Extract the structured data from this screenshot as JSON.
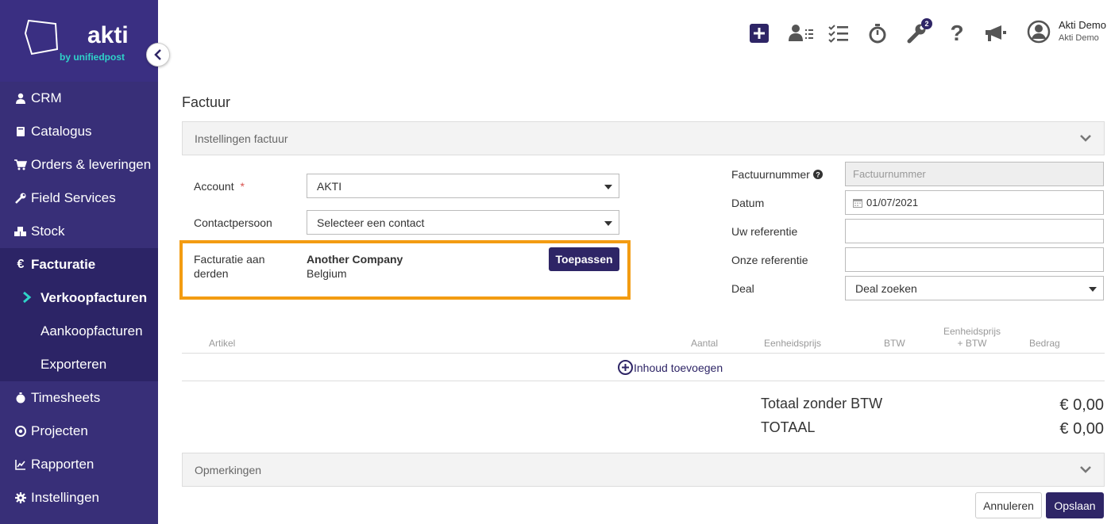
{
  "brand": {
    "name": "akti",
    "tagline": "by unifiedpost"
  },
  "sidebar": {
    "items": [
      {
        "label": "CRM",
        "icon": "user-icon"
      },
      {
        "label": "Catalogus",
        "icon": "book-icon"
      },
      {
        "label": "Orders & leveringen",
        "icon": "cart-icon"
      },
      {
        "label": "Field Services",
        "icon": "wrench-icon"
      },
      {
        "label": "Stock",
        "icon": "boxes-icon"
      },
      {
        "label": "Facturatie",
        "icon": "euro-icon"
      },
      {
        "label": "Timesheets",
        "icon": "stopwatch-icon"
      },
      {
        "label": "Projecten",
        "icon": "target-icon"
      },
      {
        "label": "Rapporten",
        "icon": "chart-icon"
      },
      {
        "label": "Instellingen",
        "icon": "gear-icon"
      }
    ],
    "subitems": [
      {
        "label": "Verkoopfacturen"
      },
      {
        "label": "Aankoopfacturen"
      },
      {
        "label": "Exporteren"
      }
    ]
  },
  "topbar": {
    "badge_count": "2",
    "user_name": "Akti Demo",
    "user_company": "Akti Demo"
  },
  "main": {
    "title": "Factuur",
    "settings_panel": "Instellingen factuur",
    "account_label": "Account",
    "account_required": "*",
    "account_value": "AKTI",
    "contact_label": "Contactpersoon",
    "contact_value": "Selecteer een contact",
    "third_party_label": "Facturatie aan derden",
    "third_party_company": "Another Company",
    "third_party_country": "Belgium",
    "apply_button": "Toepassen",
    "invoice_number_label": "Factuurnummer",
    "invoice_number_placeholder": "Factuurnummer",
    "date_label": "Datum",
    "date_value": "01/07/2021",
    "your_ref_label": "Uw referentie",
    "our_ref_label": "Onze referentie",
    "deal_label": "Deal",
    "deal_value": "Deal zoeken",
    "table_headers": [
      "Artikel",
      "Aantal",
      "Eenheidsprijs",
      "BTW",
      "Eenheidsprijs + BTW",
      "Bedrag"
    ],
    "add_content": "Inhoud toevoegen",
    "total_excl_label": "Totaal zonder BTW",
    "total_excl_value": "€ 0,00",
    "total_label": "TOTAAL",
    "total_value": "€ 0,00",
    "remarks_panel": "Opmerkingen",
    "cancel_button": "Annuleren",
    "save_button": "Opslaan"
  },
  "colors": {
    "sidebar": "#382f78",
    "accent": "#2e2566",
    "highlight": "#f39c12",
    "teal": "#2fd3c9"
  }
}
